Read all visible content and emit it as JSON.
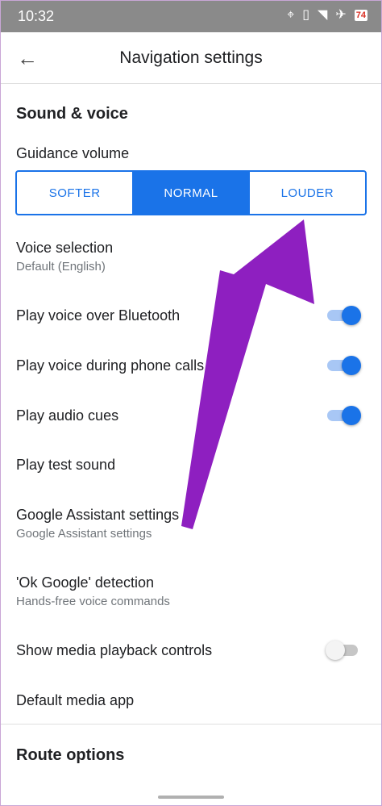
{
  "status_bar": {
    "time": "10:32",
    "icons": [
      "location-icon",
      "vibrate-icon",
      "wifi-icon",
      "airplane-icon",
      "battery-icon"
    ],
    "battery_level": "74"
  },
  "app_bar": {
    "title": "Navigation settings",
    "back_icon": "arrow-back-icon"
  },
  "sound_voice": {
    "section_title": "Sound & voice",
    "guidance_volume": {
      "label": "Guidance volume",
      "options": [
        "SOFTER",
        "NORMAL",
        "LOUDER"
      ],
      "selected": "NORMAL"
    },
    "voice_selection": {
      "label": "Voice selection",
      "value": "Default (English)"
    },
    "bluetooth": {
      "label": "Play voice over Bluetooth",
      "enabled": true
    },
    "phone_calls": {
      "label": "Play voice during phone calls",
      "enabled": true
    },
    "audio_cues": {
      "label": "Play audio cues",
      "enabled": true
    },
    "test_sound": {
      "label": "Play test sound"
    },
    "assistant": {
      "label": "Google Assistant settings",
      "sublabel": "Google Assistant settings"
    },
    "ok_google": {
      "label": "'Ok Google' detection",
      "sublabel": "Hands-free voice commands"
    },
    "media_controls": {
      "label": "Show media playback controls",
      "enabled": false
    },
    "default_media": {
      "label": "Default media app"
    }
  },
  "route_options": {
    "section_title": "Route options"
  },
  "colors": {
    "accent": "#1a73e8",
    "annotation_arrow": "#8e1fc0",
    "status_bar": "#8a8a8a"
  }
}
